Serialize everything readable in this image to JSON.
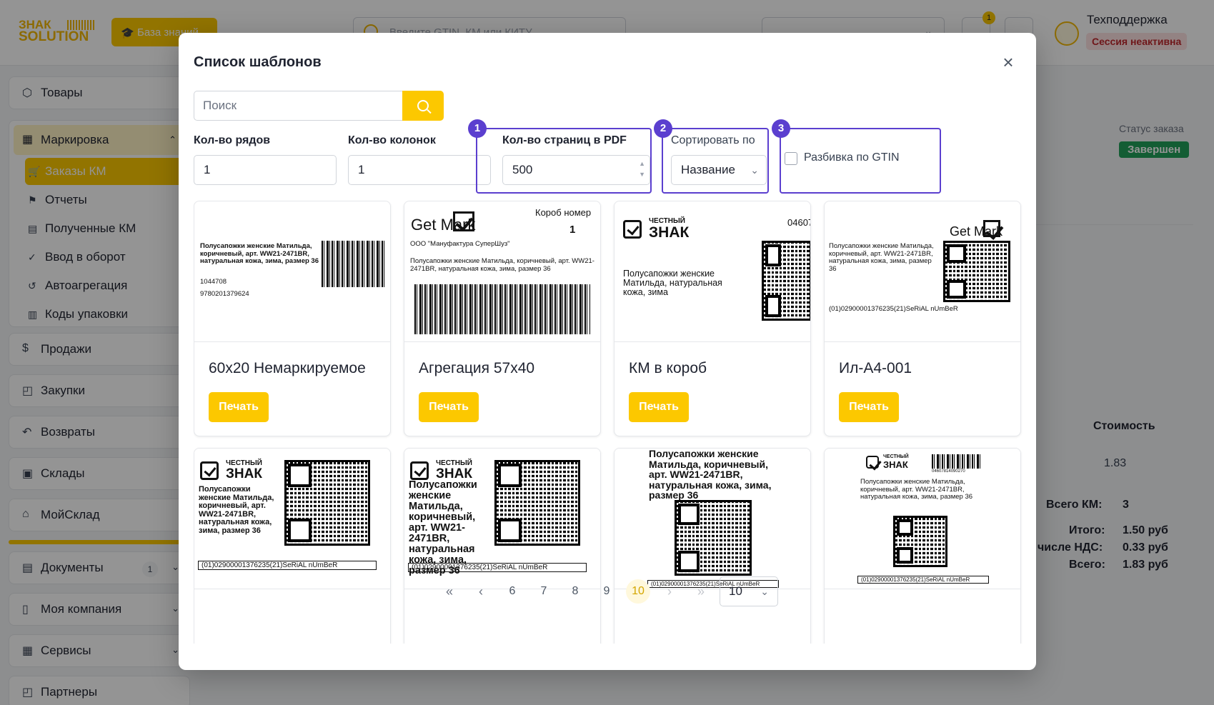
{
  "header": {
    "logo_line1": "ЗНАК",
    "logo_line2": "SOLUTION",
    "knowledge_base_label": "База знаний",
    "global_search_placeholder": "Введите GTIN, КМ или КИТУ",
    "notifications_count": "1",
    "user_name": "Техподдержка",
    "session_status": "Сессия неактивна"
  },
  "sidebar": {
    "items": [
      {
        "label": "Товары",
        "icon": "cube-icon"
      },
      {
        "label": "Маркировка",
        "icon": "grid-icon",
        "expanded": true
      },
      {
        "label": "Продажи",
        "icon": "dollar-icon"
      },
      {
        "label": "Закупки",
        "icon": "bag-icon"
      },
      {
        "label": "Возвраты",
        "icon": "return-icon"
      },
      {
        "label": "Склады",
        "icon": "warehouse-icon"
      },
      {
        "label": "МойСклад",
        "icon": "bank-icon"
      },
      {
        "label": "Документы",
        "icon": "document-icon",
        "count": "1"
      },
      {
        "label": "Моя компания",
        "icon": "building-icon"
      },
      {
        "label": "Сервисы",
        "icon": "services-icon"
      },
      {
        "label": "Партнеры",
        "icon": "partners-icon"
      }
    ],
    "marking_subitems": [
      {
        "label": "Заказы КМ",
        "active": true
      },
      {
        "label": "Отчеты"
      },
      {
        "label": "Полученные КМ"
      },
      {
        "label": "Ввод в оборот"
      },
      {
        "label": "Автоагрегация"
      },
      {
        "label": "Коды упаковки"
      }
    ]
  },
  "background": {
    "order_status_label": "Статус заказа",
    "order_status_value": "Завершен",
    "cost_header": "Стоимость",
    "cost_value": "1.83",
    "summary": [
      {
        "label": "Всего КМ:",
        "value": "3"
      },
      {
        "label": "Итого:",
        "value": "1.50 руб"
      },
      {
        "label": "числе НДС:",
        "value": "0.33 руб"
      },
      {
        "label": "Всего:",
        "value": "1.83 руб"
      }
    ]
  },
  "modal": {
    "title": "Список шаблонов",
    "search_placeholder": "Поиск",
    "rows_label": "Кол-во рядов",
    "rows_value": "1",
    "cols_label": "Кол-во колонок",
    "cols_value": "1",
    "pages_label": "Кол-во страниц в PDF",
    "pages_value": "500",
    "sort_label": "Сортировать по",
    "sort_value": "Название",
    "split_label": "Разбивка по GTIN",
    "highlight_numbers": [
      "1",
      "2",
      "3"
    ],
    "print_label": "Печать",
    "cards": [
      {
        "name": "60x20 Немаркируемое",
        "preview": {
          "desc": "Полусапожки женские Матильда, коричневый, арт. WW21-2471BR, натуральная кожа, зима, размер 36",
          "num1": "1044708",
          "num2": "9780201379624"
        }
      },
      {
        "name": "Агрегация 57x40",
        "preview": {
          "box_label": "Короб номер",
          "box_number": "1",
          "logo": "Get Mark",
          "company": "ООО \"Мануфактура СуперШуз\"",
          "desc": "Полусапожки женские Матильда, коричневый, арт. WW21-2471BR, натуральная кожа, зима, размер 36"
        }
      },
      {
        "name": "КМ в короб",
        "preview": {
          "logo_top": "ЧЕСТНЫЙ",
          "logo_main": "ЗНАК",
          "code": "04607",
          "desc": "Полусапожки женские Матильда, натуральная кожа, зима"
        }
      },
      {
        "name": "Ил-А4-001",
        "preview": {
          "logo": "Get Mark",
          "desc": "Полусапожки женские Матильда, коричневый, арт. WW21-2471BR, натуральная кожа, зима, размер 36",
          "code": "(01)02900001376235(21)SeRiAL nUmBeR"
        }
      },
      {
        "name": "",
        "preview": {
          "logo_top": "ЧЕСТНЫЙ",
          "logo_main": "ЗНАК",
          "desc": "Полусапожки женские Матильда, коричневый, арт. WW21-2471BR, натуральная кожа, зима, размер 36",
          "code": "(01)02900001376235(21)SeRiAL nUmBeR"
        }
      },
      {
        "name": "",
        "preview": {
          "logo_top": "ЧЕСТНЫЙ",
          "logo_main": "ЗНАК",
          "desc": "Полусапожки женские Матильда, коричневый, арт. WW21-2471BR, натуральная кожа, зима, размер 36",
          "code": "(01)02900001376235(21)SeRiAL nUmBeR"
        }
      },
      {
        "name": "",
        "preview": {
          "desc": "Полусапожки женские Матильда, коричневый, арт. WW21-2471BR, натуральная кожа, зима, размер 36",
          "code": "(01)02900001376235(21)SeRiAL nUmBeR"
        }
      },
      {
        "name": "",
        "preview": {
          "logo_top": "ЧЕСТНЫЙ",
          "logo_main": "ЗНАК",
          "ean": "04607814090270",
          "desc": "Полусапожки женские Матильда, коричневый, арт. WW21-2471BR, натуральная кожа, зима, размер 36",
          "code": "(01)02900001376235(21)SeRiAL nUmBeR"
        }
      }
    ],
    "pagination": {
      "first": "«",
      "prev": "‹",
      "pages": [
        "6",
        "7",
        "8",
        "9",
        "10"
      ],
      "active_page": "10",
      "next": "›",
      "last": "»",
      "page_size": "10"
    }
  },
  "colors": {
    "accent": "#fcc800",
    "highlight": "#5b3fcf",
    "success": "#22a05a",
    "danger": "#c0282d"
  }
}
